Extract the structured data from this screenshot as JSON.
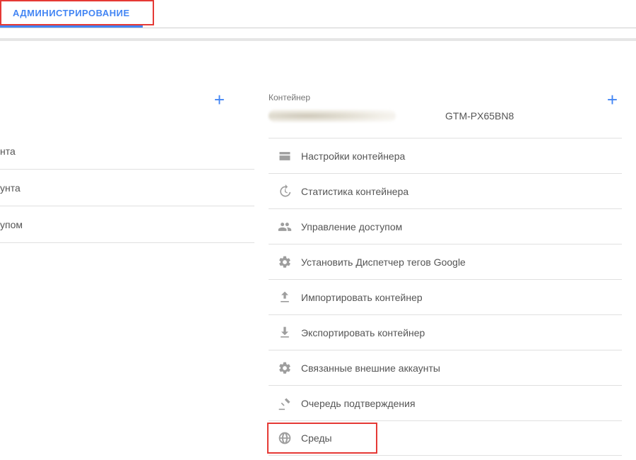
{
  "header": {
    "tab_label": "АДМИНИСТРИРОВАНИЕ"
  },
  "left_column": {
    "items": [
      "нта",
      "унта",
      "упом"
    ]
  },
  "right_column": {
    "section_label": "Контейнер",
    "container_id": "GTM-PX65BN8",
    "menu": [
      {
        "icon": "browser",
        "label": "Настройки контейнера"
      },
      {
        "icon": "history",
        "label": "Статистика контейнера"
      },
      {
        "icon": "people",
        "label": "Управление доступом"
      },
      {
        "icon": "gear",
        "label": "Установить Диспетчер тегов Google"
      },
      {
        "icon": "upload",
        "label": "Импортировать контейнер"
      },
      {
        "icon": "download",
        "label": "Экспортировать контейнер"
      },
      {
        "icon": "gear",
        "label": "Связанные внешние аккаунты"
      },
      {
        "icon": "gavel",
        "label": "Очередь подтверждения"
      },
      {
        "icon": "globe",
        "label": "Среды"
      }
    ]
  },
  "plus_glyph": "+"
}
